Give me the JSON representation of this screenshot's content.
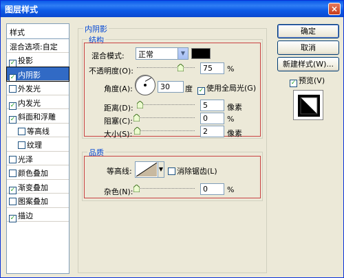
{
  "window": {
    "title": "图层样式"
  },
  "sidebar": {
    "header": "样式",
    "blend_options": "混合选项:自定",
    "items": [
      {
        "label": "投影",
        "checked": true,
        "indent": false
      },
      {
        "label": "内阴影",
        "checked": true,
        "indent": false,
        "selected": true
      },
      {
        "label": "外发光",
        "checked": false,
        "indent": false
      },
      {
        "label": "内发光",
        "checked": true,
        "indent": false
      },
      {
        "label": "斜面和浮雕",
        "checked": true,
        "indent": false
      },
      {
        "label": "等高线",
        "checked": false,
        "indent": true
      },
      {
        "label": "纹理",
        "checked": false,
        "indent": true
      },
      {
        "label": "光泽",
        "checked": false,
        "indent": false
      },
      {
        "label": "颜色叠加",
        "checked": false,
        "indent": false
      },
      {
        "label": "渐变叠加",
        "checked": true,
        "indent": false
      },
      {
        "label": "图案叠加",
        "checked": false,
        "indent": false
      },
      {
        "label": "描边",
        "checked": true,
        "indent": false
      }
    ]
  },
  "panel": {
    "section_title": "内阴影",
    "structure": {
      "group_label": "结构",
      "blend_mode_label": "混合模式:",
      "blend_mode_value": "正常",
      "blend_color": "#000000",
      "opacity_label": "不透明度(O):",
      "opacity_value": "75",
      "opacity_unit": "%",
      "opacity_fraction": 0.75,
      "angle_label": "角度(A):",
      "angle_value": "30",
      "angle_unit": "度",
      "global_light_label": "使用全局光(G)",
      "global_light_checked": true,
      "distance_label": "距离(D):",
      "distance_value": "5",
      "distance_unit": "像素",
      "choke_label": "阻塞(C):",
      "choke_value": "0",
      "choke_unit": "%",
      "size_label": "大小(S):",
      "size_value": "2",
      "size_unit": "像素"
    },
    "quality": {
      "group_label": "品质",
      "contour_label": "等高线:",
      "antialias_label": "消除锯齿(L)",
      "antialias_checked": false,
      "noise_label": "杂色(N):",
      "noise_value": "0",
      "noise_unit": "%"
    }
  },
  "buttons": {
    "ok": "确定",
    "cancel": "取消",
    "new_style": "新建样式(W)...",
    "preview_label": "预览(V)",
    "preview_checked": true
  }
}
